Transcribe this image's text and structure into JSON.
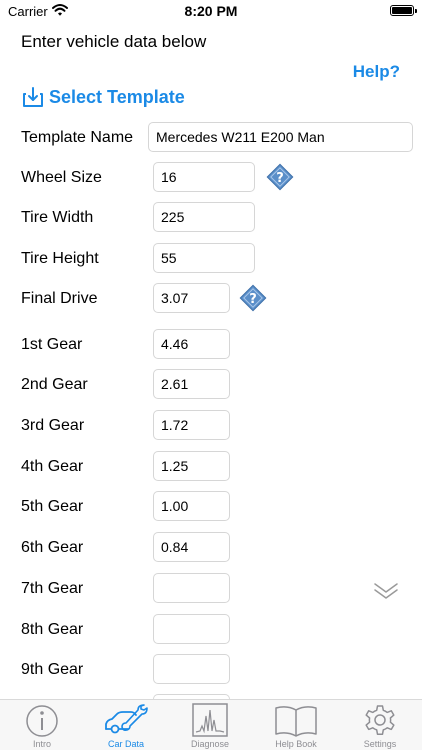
{
  "status": {
    "carrier": "Carrier",
    "time": "8:20 PM"
  },
  "header": {
    "title": "Enter vehicle data below",
    "help_label": "Help?",
    "select_template_label": "Select Template"
  },
  "form": {
    "template_name": {
      "label": "Template Name",
      "value": "Mercedes W211 E200 Man"
    },
    "wheel_size": {
      "label": "Wheel Size",
      "value": "16"
    },
    "tire_width": {
      "label": "Tire Width",
      "value": "225"
    },
    "tire_height": {
      "label": "Tire Height",
      "value": "55"
    },
    "final_drive": {
      "label": "Final Drive",
      "value": "3.07"
    },
    "gears": [
      {
        "label": "1st Gear",
        "value": "4.46"
      },
      {
        "label": "2nd Gear",
        "value": "2.61"
      },
      {
        "label": "3rd Gear",
        "value": "1.72"
      },
      {
        "label": "4th Gear",
        "value": "1.25"
      },
      {
        "label": "5th Gear",
        "value": "1.00"
      },
      {
        "label": "6th Gear",
        "value": "0.84"
      },
      {
        "label": "7th Gear",
        "value": ""
      },
      {
        "label": "8th Gear",
        "value": ""
      },
      {
        "label": "9th Gear",
        "value": ""
      }
    ]
  },
  "tabs": [
    {
      "label": "Intro",
      "icon": "info-icon",
      "active": false
    },
    {
      "label": "Car Data",
      "icon": "car-wrench-icon",
      "active": true
    },
    {
      "label": "Diagnose",
      "icon": "chart-icon",
      "active": false
    },
    {
      "label": "Help Book",
      "icon": "book-icon",
      "active": false
    },
    {
      "label": "Settings",
      "icon": "gear-icon",
      "active": false
    }
  ],
  "colors": {
    "accent": "#1b8ae6",
    "info_badge": "#5b8fc9",
    "tab_inactive": "#8e8e93"
  }
}
